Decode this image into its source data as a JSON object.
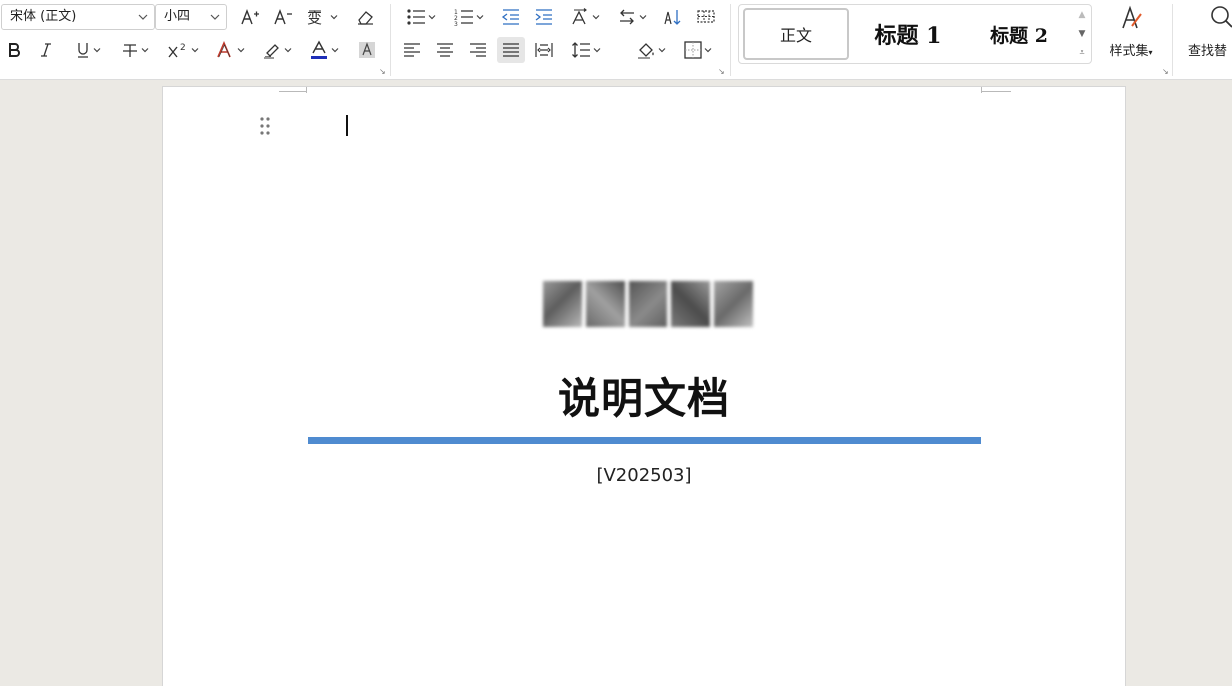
{
  "ribbon": {
    "font": {
      "family_value": "宋体 (正文)",
      "size_value": "小四"
    },
    "styles": {
      "items": [
        {
          "label": "正文"
        },
        {
          "label": "标题 1"
        },
        {
          "label": "标题 2"
        }
      ],
      "style_set_label": "样式集"
    },
    "find_replace_label": "查找替"
  },
  "colors": {
    "font_color_underline": "#1e2fb8",
    "title_rule": "#4f8bd0",
    "ribbon_bg": "#ffffff",
    "workspace_bg": "#ebe9e4"
  },
  "document": {
    "blurred_line_note": "",
    "title": "说明文档",
    "version": "[V202503]"
  }
}
